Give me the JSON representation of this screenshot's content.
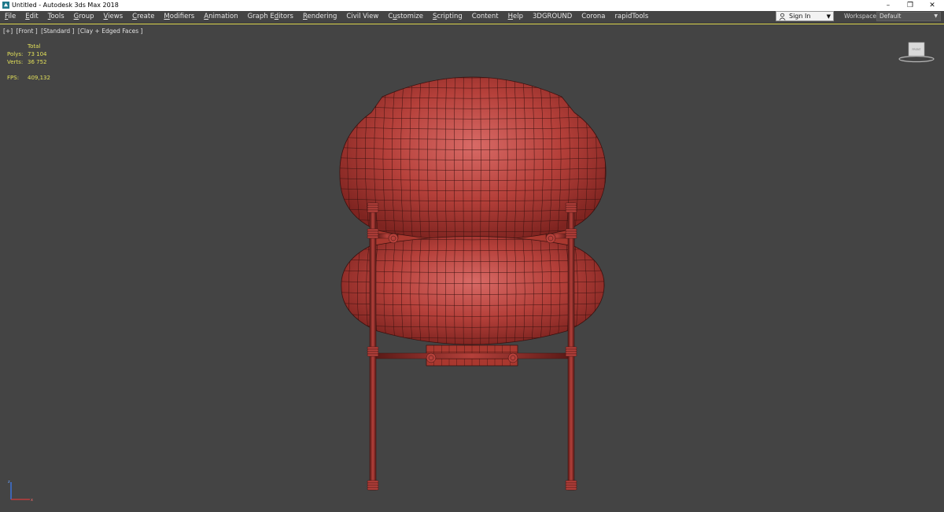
{
  "window": {
    "title": "Untitled - Autodesk 3ds Max 2018",
    "minimize_glyph": "–",
    "restore_glyph": "❐",
    "close_glyph": "✕"
  },
  "menu": [
    {
      "pre": "",
      "ul": "F",
      "post": "ile"
    },
    {
      "pre": "",
      "ul": "E",
      "post": "dit"
    },
    {
      "pre": "",
      "ul": "T",
      "post": "ools"
    },
    {
      "pre": "",
      "ul": "G",
      "post": "roup"
    },
    {
      "pre": "",
      "ul": "V",
      "post": "iews"
    },
    {
      "pre": "",
      "ul": "C",
      "post": "reate"
    },
    {
      "pre": "",
      "ul": "M",
      "post": "odifiers"
    },
    {
      "pre": "",
      "ul": "A",
      "post": "nimation"
    },
    {
      "pre": "Graph E",
      "ul": "d",
      "post": "itors"
    },
    {
      "pre": "",
      "ul": "R",
      "post": "endering"
    },
    {
      "pre": "Civil View",
      "ul": "",
      "post": ""
    },
    {
      "pre": "C",
      "ul": "u",
      "post": "stomize"
    },
    {
      "pre": "",
      "ul": "S",
      "post": "cripting"
    },
    {
      "pre": "Content",
      "ul": "",
      "post": ""
    },
    {
      "pre": "",
      "ul": "H",
      "post": "elp"
    },
    {
      "pre": "3DGROUND",
      "ul": "",
      "post": ""
    },
    {
      "pre": "Corona",
      "ul": "",
      "post": ""
    },
    {
      "pre": "rapidTools",
      "ul": "",
      "post": ""
    }
  ],
  "signin": {
    "label": "Sign In",
    "caret": "▼"
  },
  "workspaces": {
    "label": "Workspaces:",
    "value": "Default",
    "caret": "▼"
  },
  "viewport": {
    "labels": [
      "[+]",
      "[Front ]",
      "[Standard ]",
      "[Clay + Edged Faces ]"
    ],
    "stats": {
      "header": "Total",
      "polys_label": "Polys:",
      "polys_value": "73 104",
      "verts_label": "Verts:",
      "verts_value": "36 752",
      "fps_label": "FPS:",
      "fps_value": "409,132"
    },
    "viewcube_label": "FRONT",
    "colors": {
      "background": "#444444",
      "model": "#b5403a",
      "wire": "#3a1210",
      "stats_text": "#e2e05a",
      "border": "#e0d850"
    }
  }
}
